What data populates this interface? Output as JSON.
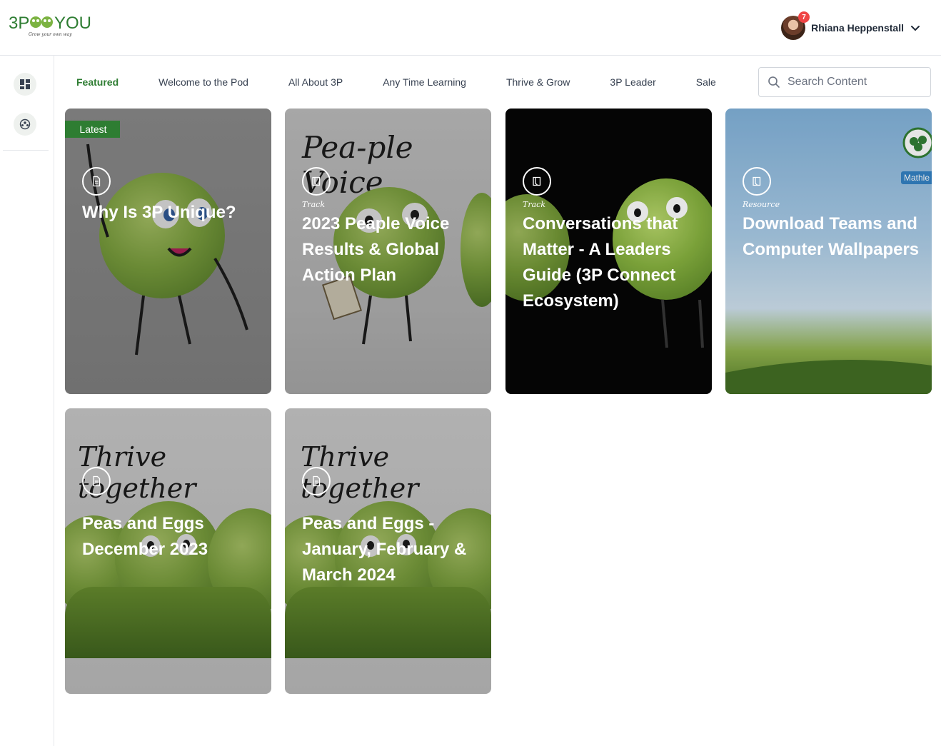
{
  "header": {
    "logo_text": "3P YOU",
    "logo_tagline": "Grow your own way",
    "user_name": "Rhiana Heppenstall",
    "notification_count": "7"
  },
  "tabs": [
    {
      "label": "Featured",
      "active": true
    },
    {
      "label": "Welcome to the Pod",
      "active": false
    },
    {
      "label": "All About 3P",
      "active": false
    },
    {
      "label": "Any Time Learning",
      "active": false
    },
    {
      "label": "Thrive & Grow",
      "active": false
    },
    {
      "label": "3P Leader",
      "active": false
    },
    {
      "label": "Sale",
      "active": false
    }
  ],
  "search": {
    "placeholder": "Search Content"
  },
  "cards": [
    {
      "title": "Why Is 3P Unique?",
      "type": "",
      "icon": "document-icon",
      "badge": "Latest"
    },
    {
      "title": "2023 Peaple Voice Results & Global Action Plan",
      "type": "Track",
      "icon": "book-icon",
      "image_text": "Pea-ple Voice"
    },
    {
      "title": "Conversations that Matter - A Leaders Guide (3P Connect Ecosystem)",
      "type": "Track",
      "icon": "book-icon"
    },
    {
      "title": "Download Teams and Computer Wallpapers",
      "type": "Resource",
      "icon": "book-icon",
      "image_text": "Mathle"
    },
    {
      "title": "Peas and Eggs December 2023",
      "type": "",
      "icon": "document-icon",
      "image_text": "Thrive together"
    },
    {
      "title": "Peas and Eggs - January, February & March 2024",
      "type": "",
      "icon": "document-icon",
      "image_text": "Thrive together"
    }
  ],
  "colors": {
    "accent": "#2e7d32",
    "badge": "#ef4444"
  }
}
